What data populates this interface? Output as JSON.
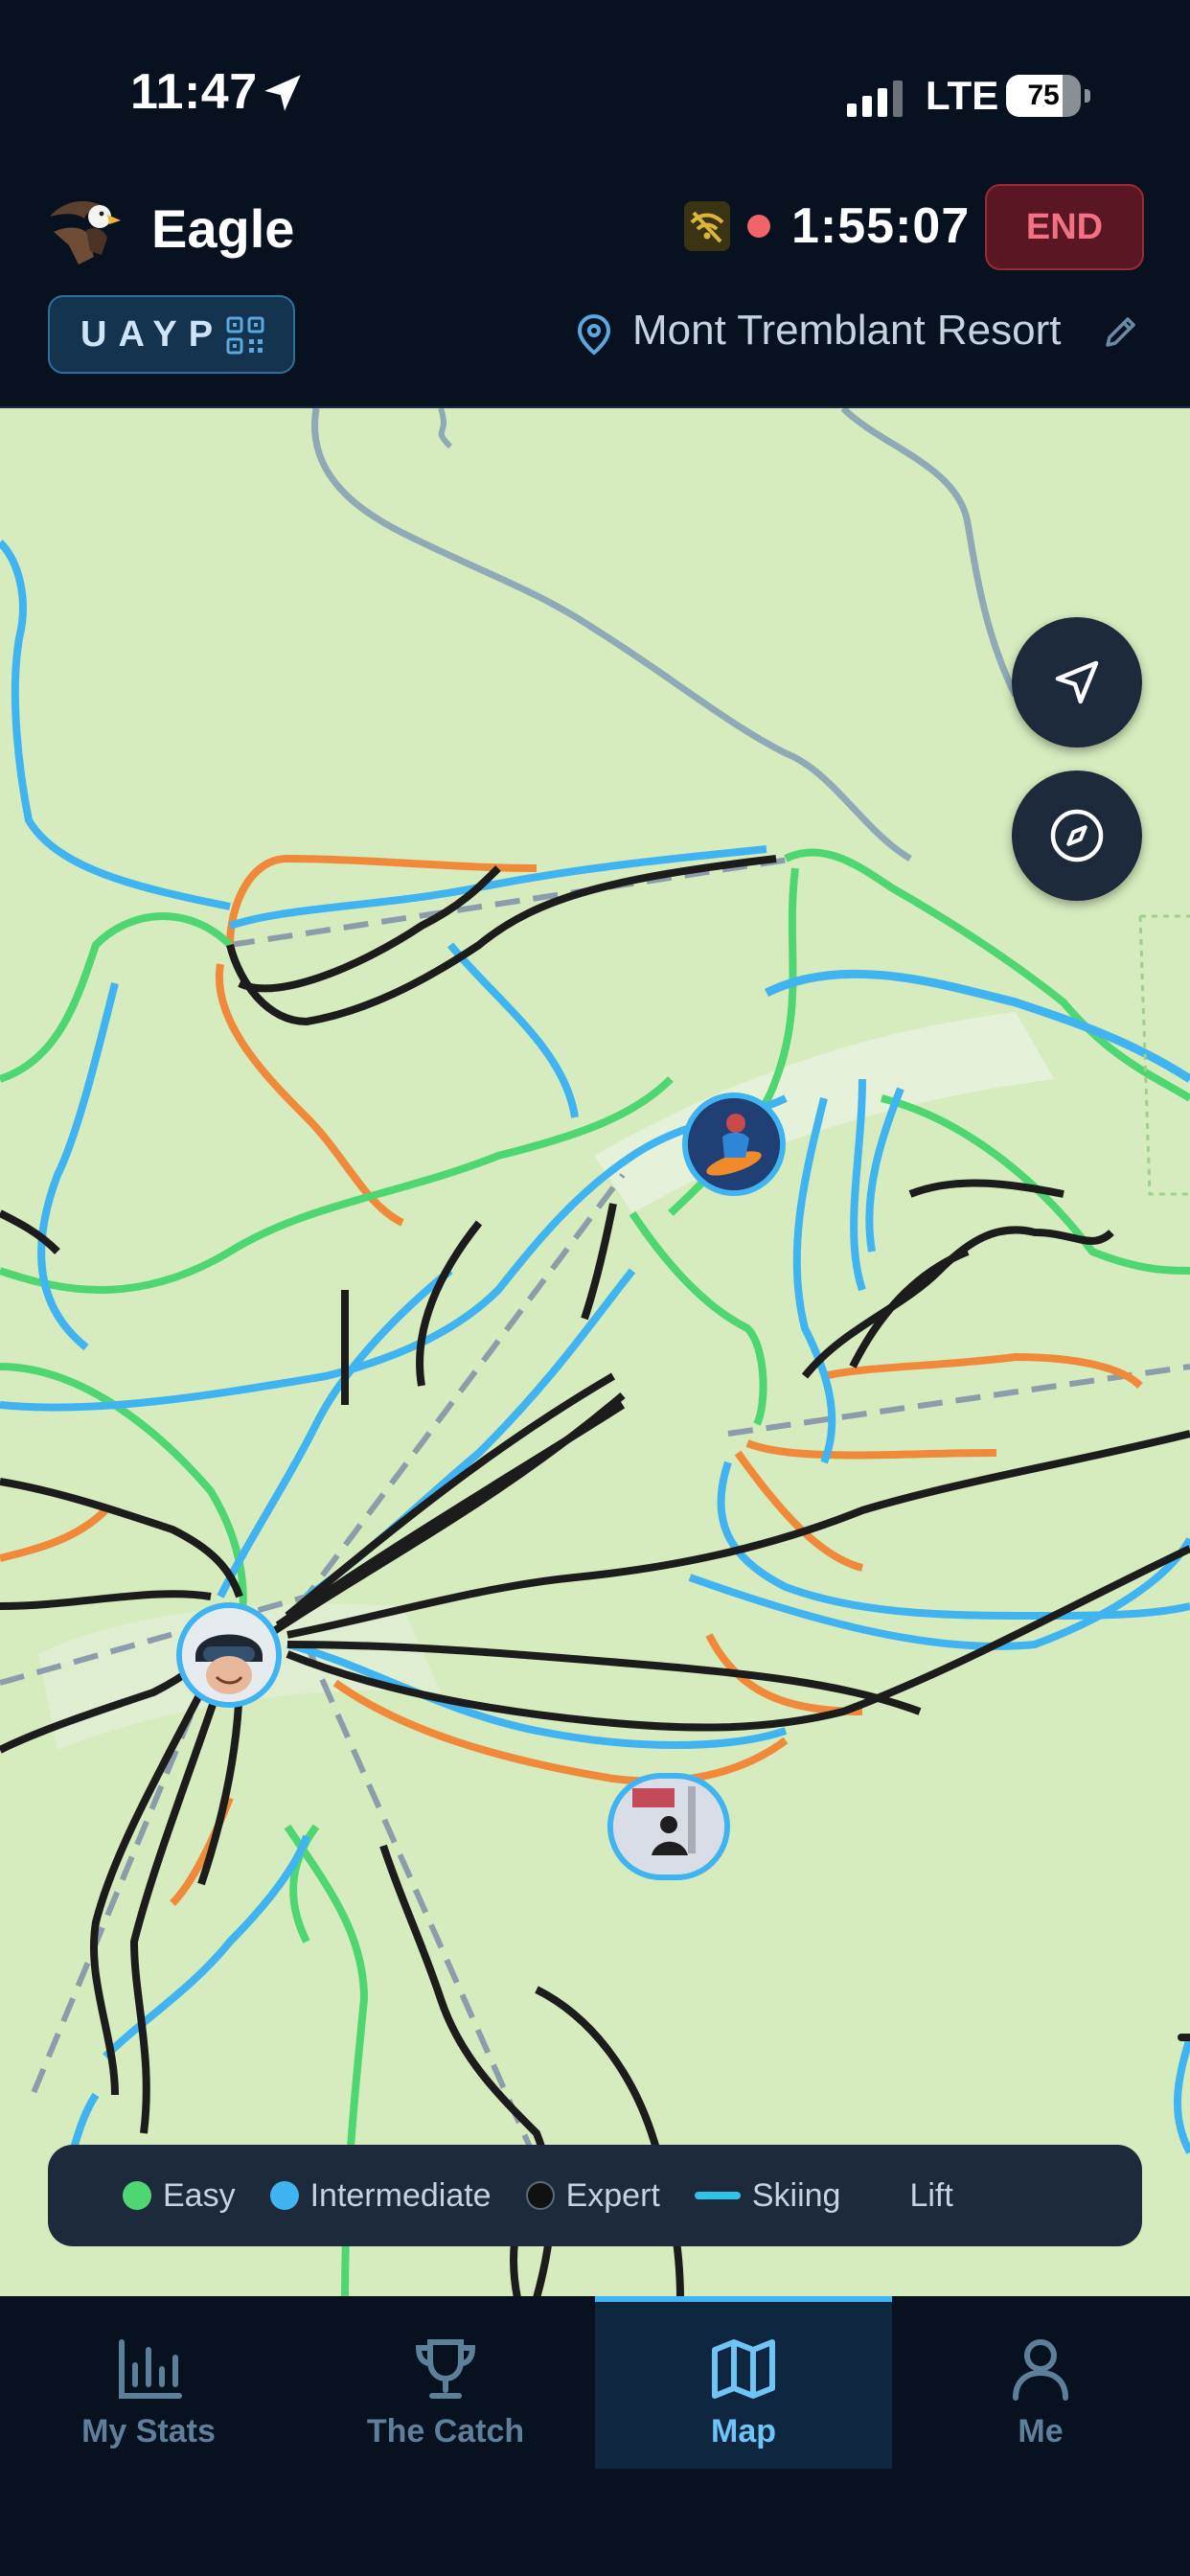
{
  "status_bar": {
    "time": "11:47",
    "network": "LTE",
    "battery_percent": 75
  },
  "header": {
    "user_name": "Eagle",
    "timer": "1:55:07",
    "end_label": "END",
    "group_code": "UAYP",
    "resort_name": "Mont Tremblant Resort"
  },
  "map": {
    "buttons": [
      "locate",
      "compass"
    ]
  },
  "legend": {
    "items": [
      {
        "label": "Easy",
        "color": "#4ed672"
      },
      {
        "label": "Intermediate",
        "color": "#3fb4f0"
      },
      {
        "label": "Expert",
        "color": "#111111"
      },
      {
        "label": "Skiing",
        "color": "#2fc3ea"
      },
      {
        "label": "Lift",
        "color": "#8fa3b5"
      }
    ]
  },
  "tabs": [
    {
      "label": "My Stats",
      "icon": "bar-chart-icon",
      "active": false
    },
    {
      "label": "The Catch",
      "icon": "trophy-icon",
      "active": false
    },
    {
      "label": "Map",
      "icon": "map-icon",
      "active": true
    },
    {
      "label": "Me",
      "icon": "person-icon",
      "active": false
    }
  ],
  "colors": {
    "background": "#07111f",
    "accent": "#3fb4f0",
    "end": "#f27283",
    "map": "#d6ebbe"
  }
}
